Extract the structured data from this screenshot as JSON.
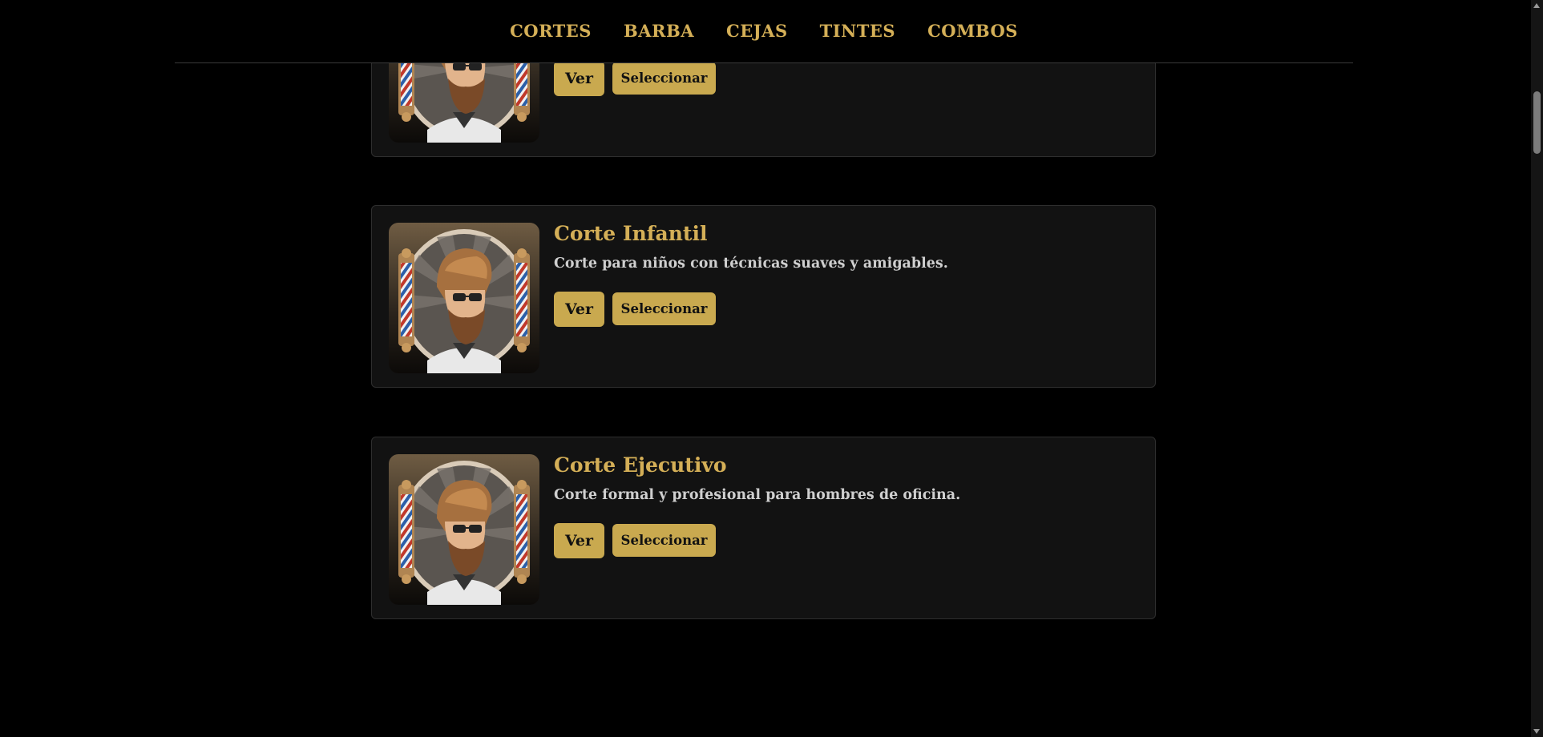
{
  "nav": {
    "items": [
      {
        "label": "CORTES"
      },
      {
        "label": "BARBA"
      },
      {
        "label": "CEJAS"
      },
      {
        "label": "TINTES"
      },
      {
        "label": "COMBOS"
      }
    ]
  },
  "cards": [
    {
      "title": "",
      "description": "",
      "view_label": "Ver",
      "select_label": "Seleccionar"
    },
    {
      "title": "Corte Infantil",
      "description": "Corte para niños con técnicas suaves y amigables.",
      "view_label": "Ver",
      "select_label": "Seleccionar"
    },
    {
      "title": "Corte Ejecutivo",
      "description": "Corte formal y profesional para hombres de oficina.",
      "view_label": "Ver",
      "select_label": "Seleccionar"
    }
  ],
  "icons": {
    "thumbnail": "barber-logo-icon",
    "scroll_up": "arrow-up-icon",
    "scroll_down": "arrow-down-icon"
  },
  "colors": {
    "background": "#000000",
    "card": "#121212",
    "accent": "#d4af57",
    "button": "#c9a94f",
    "text": "#cfcfcf"
  }
}
